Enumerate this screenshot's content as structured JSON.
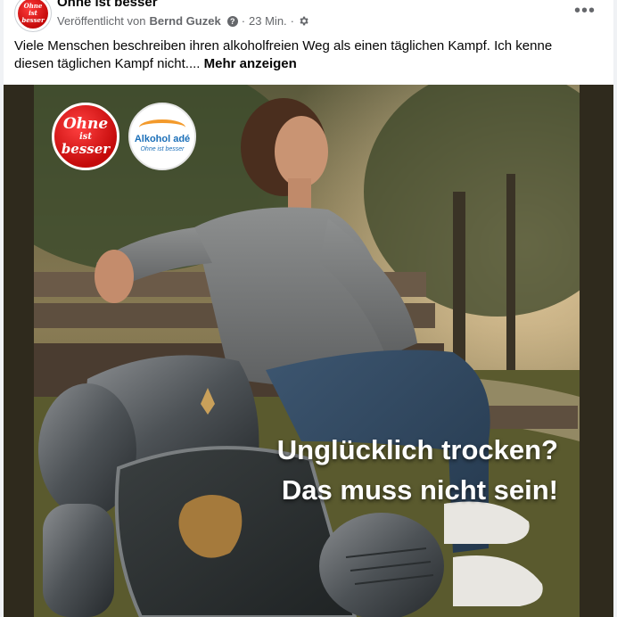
{
  "post": {
    "page_name": "Ohne ist besser",
    "published_by_label": "Veröffentlicht von",
    "author": "Bernd Guzek",
    "help_glyph": "?",
    "separator": "·",
    "time": "23 Min.",
    "more_glyph": "•••",
    "text": "Viele Menschen beschreiben ihren alkoholfreien Weg als einen täglichen Kampf.  Ich kenne diesen täglichen Kampf nicht.... ",
    "see_more": "Mehr anzeigen"
  },
  "avatar": {
    "line1": "Ohne",
    "line2": "ist",
    "line3": "besser"
  },
  "image": {
    "logo_ohne": {
      "line1": "Ohne",
      "line2": "ist",
      "line3": "besser"
    },
    "logo_ade": {
      "title": "Alkohol adé",
      "tagline": "Ohne ist besser"
    },
    "headline_line1": "Unglücklich trocken?",
    "headline_line2": "Das muss nicht sein!"
  },
  "colors": {
    "brand_red": "#c40a0a",
    "ade_blue": "#1b6fb8",
    "ade_orange": "#f39a2c",
    "meta_gray": "#65676b"
  }
}
